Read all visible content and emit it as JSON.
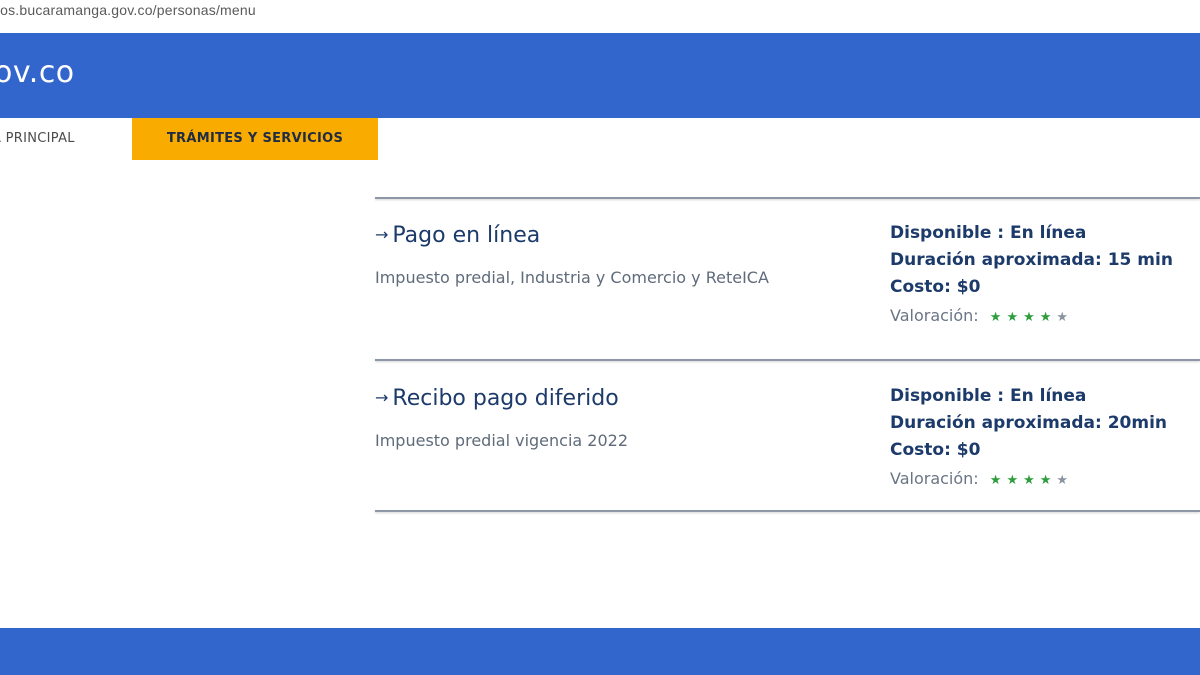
{
  "browser": {
    "url": "tos.bucaramanga.gov.co/personas/menu"
  },
  "header": {
    "brand": "ov.co"
  },
  "tabs": [
    {
      "label": "A PRINCIPAL",
      "active": false
    },
    {
      "label": "TRÁMITES Y SERVICIOS",
      "active": true
    }
  ],
  "services": [
    {
      "arrow": "→",
      "title": "Pago en línea",
      "description": "Impuesto predial, Industria y Comercio y ReteICA",
      "availability": "Disponible : En línea",
      "duration": "Duración aproximada: 15 min",
      "cost": "Costo: $0",
      "rating_label": "Valoración:",
      "rating": 4,
      "rating_max": 5
    },
    {
      "arrow": "→",
      "title": "Recibo pago diferido",
      "description": "Impuesto predial vigencia 2022",
      "availability": "Disponible : En línea",
      "duration": "Duración aproximada: 20min",
      "cost": "Costo: $0",
      "rating_label": "Valoración:",
      "rating": 4,
      "rating_max": 5
    }
  ],
  "colors": {
    "header_blue": "#3366cc",
    "tab_active": "#f9ab00",
    "title_navy": "#1c3a6a",
    "star_green": "#2e9e3c"
  },
  "icons": {
    "service_arrow": "arrow-right-icon",
    "rating_star": "star-icon"
  }
}
